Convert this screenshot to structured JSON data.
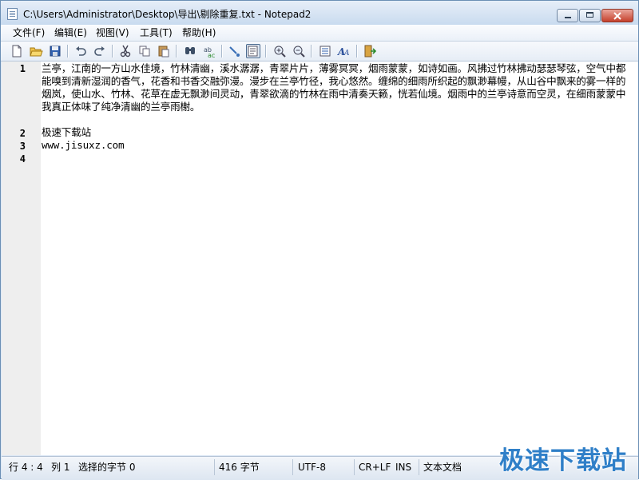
{
  "window": {
    "title": "C:\\Users\\Administrator\\Desktop\\导出\\剔除重复.txt - Notepad2",
    "min_icon": "minimize-icon",
    "max_icon": "maximize-icon",
    "close_icon": "close-icon"
  },
  "menu": {
    "items": [
      "文件(F)",
      "编辑(E)",
      "视图(V)",
      "工具(T)",
      "帮助(H)"
    ]
  },
  "toolbar": {
    "buttons": [
      "new-file-icon",
      "open-folder-icon",
      "save-icon",
      "undo-icon",
      "redo-icon",
      "cut-icon",
      "copy-icon",
      "paste-icon",
      "find-icon",
      "replace-icon",
      "wrap-icon",
      "view-whitespace-icon",
      "zoom-in-icon",
      "zoom-out-icon",
      "scheme-icon",
      "font-icon",
      "exit-icon"
    ]
  },
  "editor": {
    "line_numbers": [
      "1",
      "2",
      "3",
      "4"
    ],
    "lines": [
      "兰亭，江南的一方山水佳境，竹林清幽，溪水潺潺，青翠片片，薄雾冥冥，烟雨蒙蒙，如诗如画。风拂过竹林拂动瑟瑟琴弦，空气中都能嗅到清新湿润的香气，花香和书香交融弥漫。漫步在兰亭竹径，我心悠然。缠绵的细雨所织起的飘渺幕幔，从山谷中飘来的雾一样的烟岚，使山水、竹林、花草在虚无飘渺间灵动，青翠欲滴的竹林在雨中清奏天籁，恍若仙境。烟雨中的兰亭诗意而空灵，在细雨蒙蒙中我真正体味了纯净清幽的兰亭雨榭。",
      "极速下载站",
      "www.jisuxz.com",
      ""
    ]
  },
  "status": {
    "position": "行 4 : 4",
    "column": "列 1",
    "selection": "选择的字节 0",
    "size": "416 字节",
    "encoding": "UTF-8",
    "line_ending": "CR+LF",
    "mode": "INS",
    "doc_type": "文本文档"
  },
  "watermark": "极速下载站"
}
